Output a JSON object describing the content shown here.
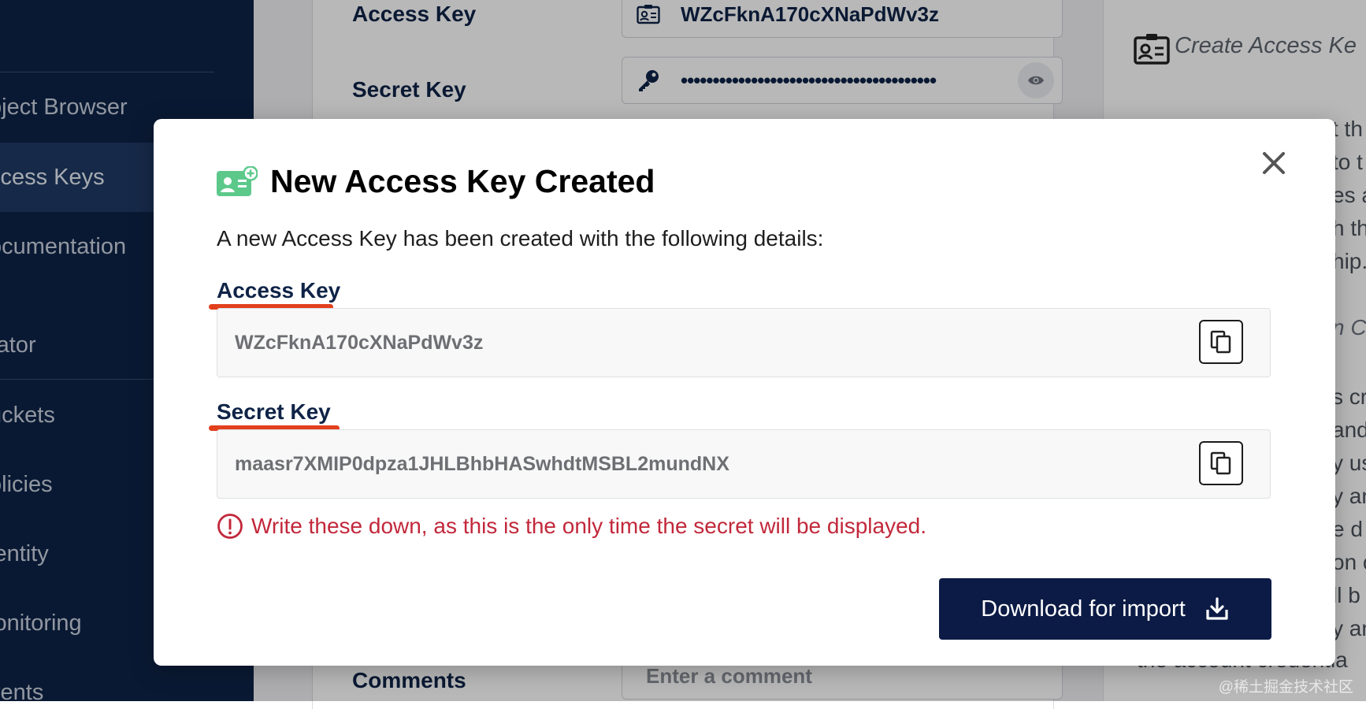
{
  "sidebar": {
    "items": [
      {
        "label": "bject Browser",
        "active": false
      },
      {
        "label": "ccess Keys",
        "active": true
      },
      {
        "label": "ocumentation",
        "active": false
      },
      {
        "label": "rator",
        "active": false
      },
      {
        "label": "uckets",
        "active": false
      },
      {
        "label": "olicies",
        "active": false
      },
      {
        "label": "lentity",
        "active": false
      },
      {
        "label": "lonitoring",
        "active": false
      },
      {
        "label": "vents",
        "active": false
      }
    ]
  },
  "form": {
    "access_key_label": "Access Key",
    "access_key_value": "WZcFknA170cXNaPdWv3z",
    "secret_key_label": "Secret Key",
    "secret_key_masked": "••••••••••••••••••••••••••••••••••••••••",
    "comments_label": "Comments",
    "comments_placeholder": "Enter a comment"
  },
  "right_panel": {
    "title": "Create Access Ke",
    "lines_top": [
      "t th",
      "to t",
      "es a",
      "h th",
      "hip."
    ],
    "subtitle_fragment": "n C",
    "lines_bottom": [
      "s cr",
      "and",
      "y us",
      "y an",
      "e d",
      "on c",
      "ll b",
      "y an"
    ],
    "footer": "the account credentia"
  },
  "modal": {
    "title": "New Access Key Created",
    "description": "A new Access Key has been created with the following details:",
    "access_key_label": "Access Key",
    "access_key_value": "WZcFknA170cXNaPdWv3z",
    "secret_key_label": "Secret Key",
    "secret_key_value": "maasr7XMIP0dpza1JHLBhbHASwhdtMSBL2mundNX",
    "warning": "Write these down, as this is the only time the secret will be displayed.",
    "download_label": "Download for import"
  },
  "watermark": "@稀土掘金技术社区",
  "colors": {
    "sidebar_bg": "#0f2347",
    "primary_button": "#0c1b45",
    "warning_red": "#c2283b",
    "annotation_underline": "#e2401d",
    "header_icon_green": "#5cc98b"
  },
  "icons": {
    "header": "id-card-plus-icon",
    "copy": "copy-icon",
    "warning": "exclamation-circle-icon",
    "download": "download-icon",
    "close": "close-icon",
    "key": "key-icon",
    "eye": "eye-icon"
  }
}
